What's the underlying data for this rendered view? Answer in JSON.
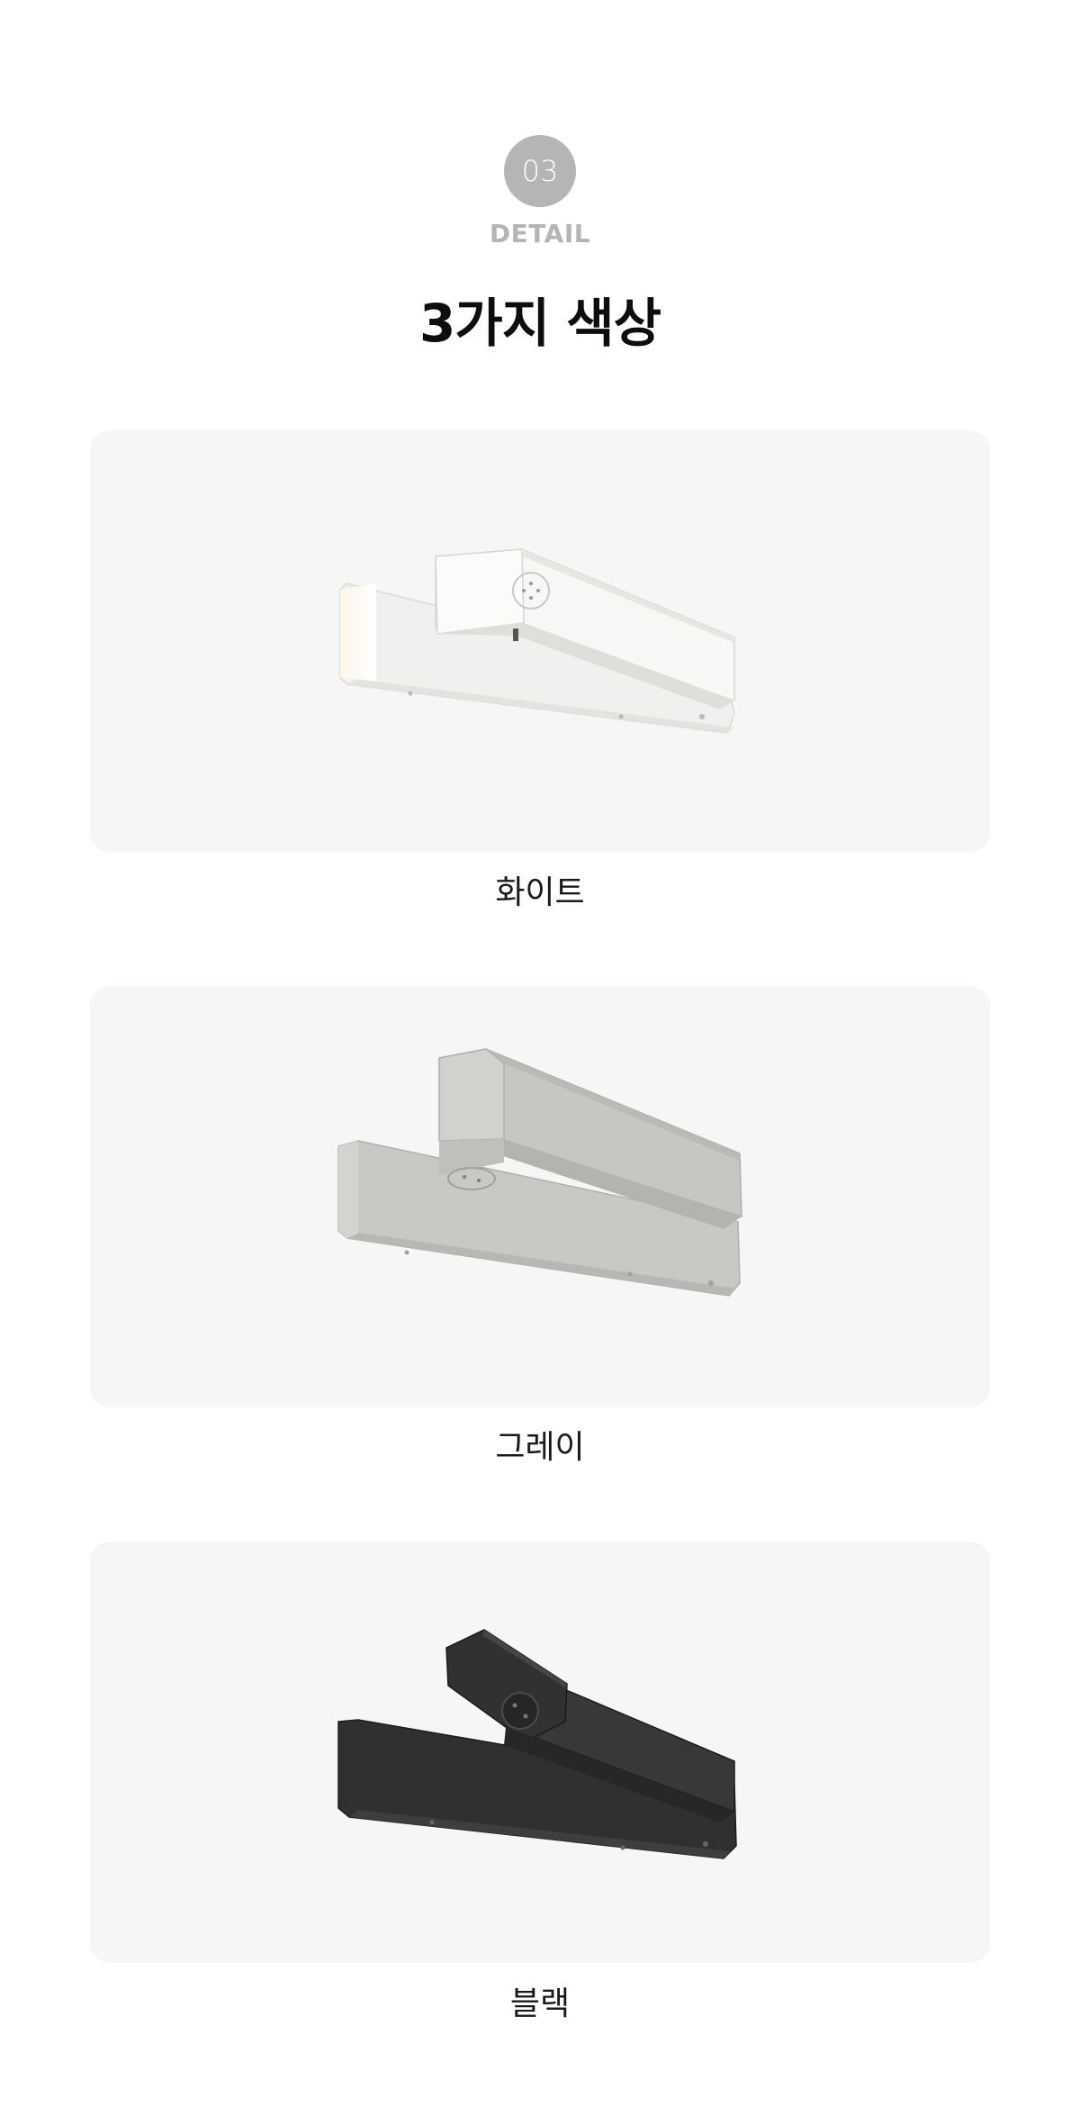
{
  "header": {
    "number": "03",
    "eyebrow": "DETAIL",
    "title": "3가지 색상"
  },
  "products": [
    {
      "label": "화이트",
      "color_name": "white",
      "swatch": "#f2f2f0"
    },
    {
      "label": "그레이",
      "color_name": "gray",
      "swatch": "#c3c5c1"
    },
    {
      "label": "블랙",
      "color_name": "black",
      "swatch": "#333333"
    }
  ]
}
